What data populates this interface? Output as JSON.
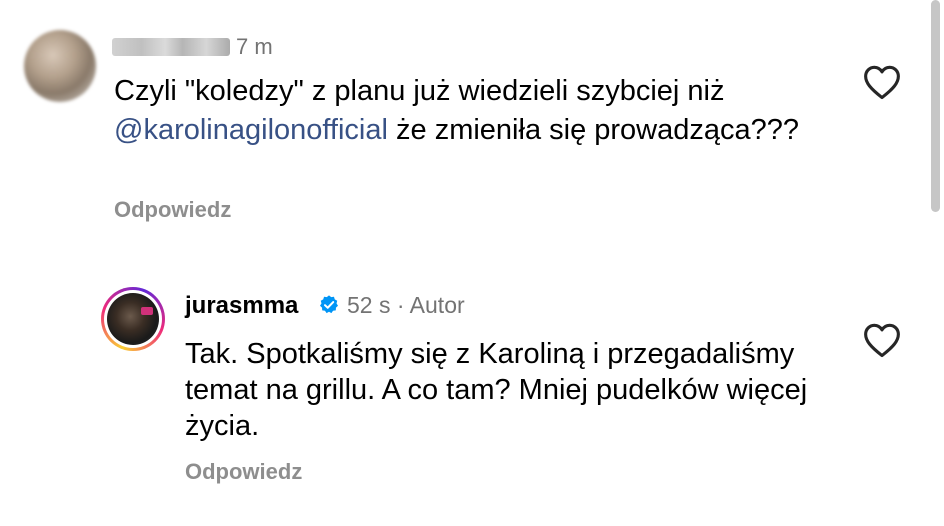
{
  "comment_1": {
    "username_redacted": true,
    "time": "7 m",
    "text_before_mention": "Czyli \"koledzy\" z planu już wiedzieli szybciej niż ",
    "mention": "@karolinagilonofficial",
    "text_after_mention": "  że zmieniła się prowadząca???",
    "reply_label": "Odpowiedz",
    "like_icon": "heart-outline-icon"
  },
  "comment_2": {
    "username": "jurasmma",
    "verified_icon": "verified-badge-icon",
    "time": "52 s",
    "separator": "·",
    "author_label": "Autor",
    "text": "Tak. Spotkaliśmy się z Karoliną i przegadaliśmy temat na grillu. A co tam? Mniej pudelków więcej życia.",
    "reply_label": "Odpowiedz",
    "like_icon": "heart-outline-icon"
  },
  "colors": {
    "text": "#000000",
    "muted": "#737373",
    "reply": "#8e8e8e",
    "mention": "#385185",
    "verified": "#0095f6"
  }
}
